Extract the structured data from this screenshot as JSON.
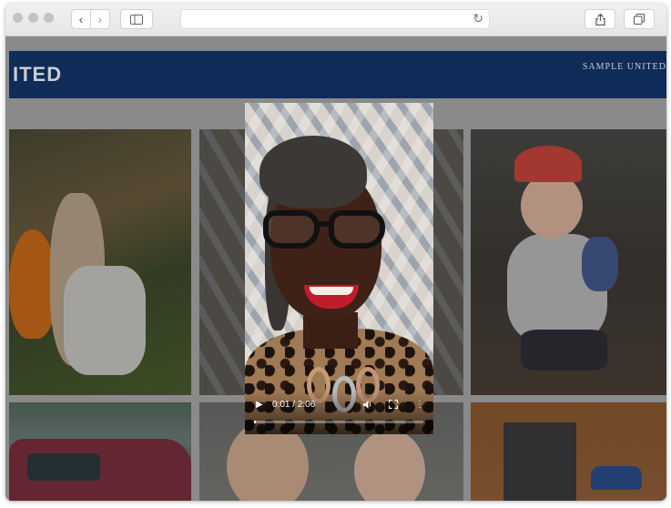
{
  "browser": {
    "traffic_lights": [
      "close",
      "minimize",
      "zoom"
    ],
    "back_icon": "chevron-left-icon",
    "forward_icon": "chevron-right-icon",
    "sidebar_icon": "sidebar-icon",
    "address_url": "",
    "reload_icon": "reload-icon",
    "share_icon": "share-icon",
    "tabs_icon": "tabs-overview-icon"
  },
  "site": {
    "brand": "ITED",
    "nav_text": "SAMPLE UNITED",
    "header_color": "#0f2b57"
  },
  "gallery": {
    "tiles": [
      "photo-girls-outdoor",
      "photo-patterned-wall",
      "photo-boy-cap",
      "photo-car-child",
      "photo-two-women",
      "photo-garage-door"
    ]
  },
  "video": {
    "current_time": "0:01",
    "duration": "2:06",
    "time_display": "0:01 / 2:06",
    "progress_fraction": 0.008,
    "play_icon": "play-icon",
    "volume_icon": "volume-icon",
    "fullscreen_icon": "fullscreen-icon",
    "more_icon": "more-vertical-icon"
  }
}
